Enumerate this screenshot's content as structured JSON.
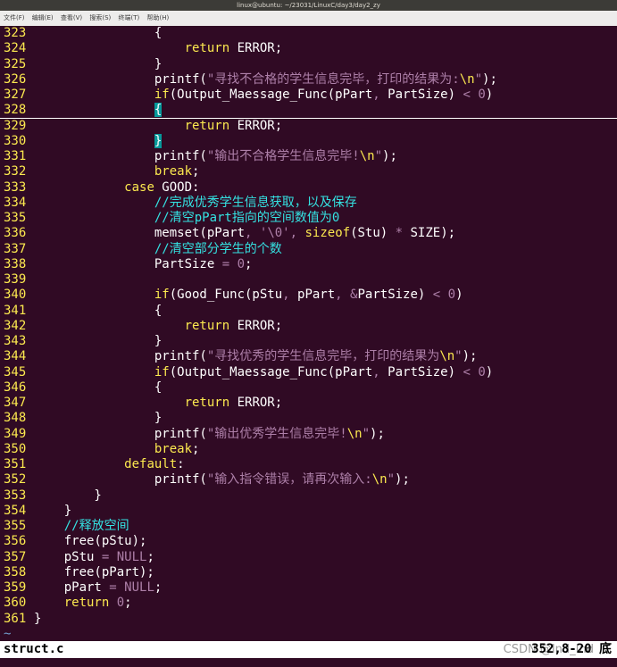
{
  "window": {
    "title": "linux@ubuntu: ~/23031/LinuxC/day3/day2_zy"
  },
  "menu": [
    "文件(F)",
    "编辑(E)",
    "查看(V)",
    "搜索(S)",
    "终端(T)",
    "帮助(H)"
  ],
  "editor": {
    "lines": [
      {
        "n": "323",
        "t": "                {"
      },
      {
        "n": "324",
        "t": "                    return ERROR;"
      },
      {
        "n": "325",
        "t": "                }"
      },
      {
        "n": "326",
        "t": "                printf(\"寻找不合格的学生信息完毕，打印的结果为:\\n\");"
      },
      {
        "n": "327",
        "t": "                if(Output_Maessage_Func(pPart, PartSize) < 0)"
      },
      {
        "n": "328",
        "t": "                {"
      },
      {
        "n": "329",
        "t": "                    return ERROR;"
      },
      {
        "n": "330",
        "t": "                }"
      },
      {
        "n": "331",
        "t": "                printf(\"输出不合格学生信息完毕!\\n\");"
      },
      {
        "n": "332",
        "t": "                break;"
      },
      {
        "n": "333",
        "t": "            case GOOD:"
      },
      {
        "n": "334",
        "t": "                //完成优秀学生信息获取，以及保存"
      },
      {
        "n": "335",
        "t": "                //清空pPart指向的空间数值为0"
      },
      {
        "n": "336",
        "t": "                memset(pPart, '\\0', sizeof(Stu) * SIZE);"
      },
      {
        "n": "337",
        "t": "                //清空部分学生的个数"
      },
      {
        "n": "338",
        "t": "                PartSize = 0;"
      },
      {
        "n": "339",
        "t": ""
      },
      {
        "n": "340",
        "t": "                if(Good_Func(pStu, pPart, &PartSize) < 0)"
      },
      {
        "n": "341",
        "t": "                {"
      },
      {
        "n": "342",
        "t": "                    return ERROR;"
      },
      {
        "n": "343",
        "t": "                }"
      },
      {
        "n": "344",
        "t": "                printf(\"寻找优秀的学生信息完毕，打印的结果为\\n\");"
      },
      {
        "n": "345",
        "t": "                if(Output_Maessage_Func(pPart, PartSize) < 0)"
      },
      {
        "n": "346",
        "t": "                {"
      },
      {
        "n": "347",
        "t": "                    return ERROR;"
      },
      {
        "n": "348",
        "t": "                }"
      },
      {
        "n": "349",
        "t": "                printf(\"输出优秀学生信息完毕!\\n\");"
      },
      {
        "n": "350",
        "t": "                break;"
      },
      {
        "n": "351",
        "t": "            default:"
      },
      {
        "n": "352",
        "t": "                printf(\"输入指令错误，请再次输入:\\n\");"
      },
      {
        "n": "353",
        "t": "        }"
      },
      {
        "n": "354",
        "t": "    }"
      },
      {
        "n": "355",
        "t": "    //释放空间"
      },
      {
        "n": "356",
        "t": "    free(pStu);"
      },
      {
        "n": "357",
        "t": "    pStu = NULL;"
      },
      {
        "n": "358",
        "t": "    free(pPart);"
      },
      {
        "n": "359",
        "t": "    pPart = NULL;"
      },
      {
        "n": "360",
        "t": "    return 0;"
      },
      {
        "n": "361",
        "t": "}"
      }
    ],
    "tilde": "~"
  },
  "status": {
    "filename": "struct.c",
    "watermark": "CSDN @Ind_Ind",
    "position": "352,8-20",
    "scroll": "底"
  },
  "colors": {
    "background": "#300a24",
    "line_number": "#fce94f",
    "keyword": "#fce94f",
    "string": "#ad7fa8",
    "comment": "#34e2e2",
    "bracket_highlight": "#06989a"
  }
}
